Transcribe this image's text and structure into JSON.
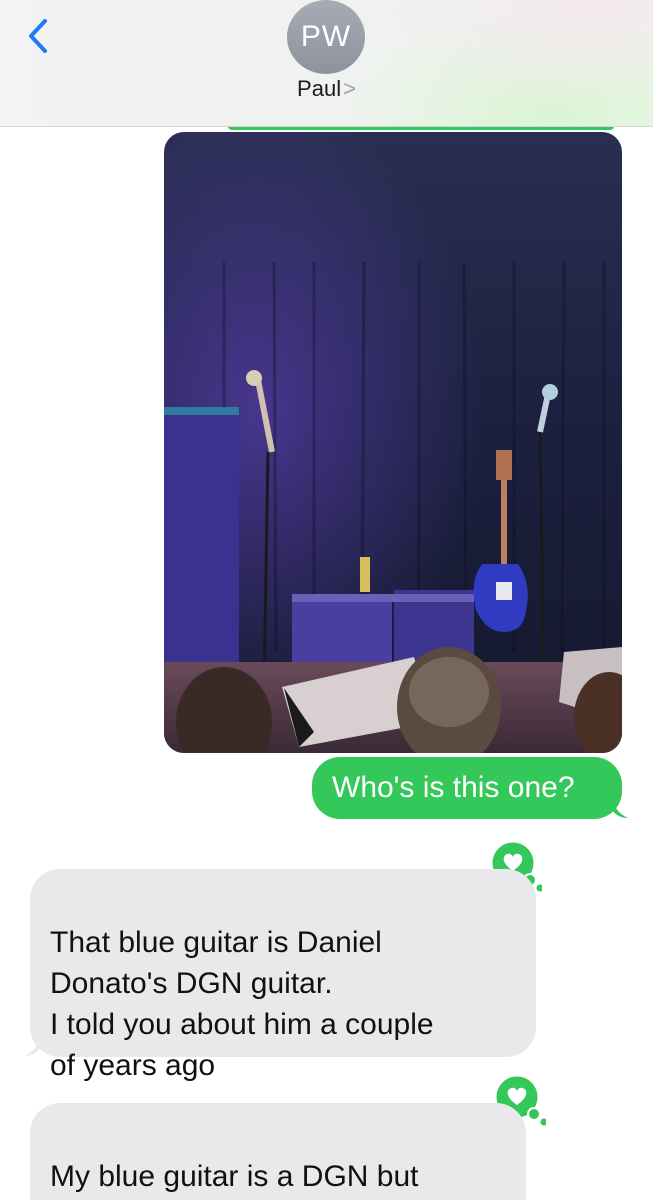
{
  "header": {
    "avatar_initials": "PW",
    "contact_name": "Paul",
    "contact_chevron": ">",
    "back_icon": "chevron-left-icon"
  },
  "messages": [
    {
      "type": "image",
      "direction": "sent",
      "description_icon": "photo-attachment"
    },
    {
      "type": "text",
      "direction": "sent",
      "text": "Who's is this one?"
    },
    {
      "type": "text",
      "direction": "received",
      "text": "That blue guitar is Daniel\nDonato's DGN guitar.\nI told you about him a couple\nof years ago",
      "tapback": "heart-icon"
    },
    {
      "type": "text",
      "direction": "received",
      "text": "My blue guitar is a DGN but\nDaniel's is his signature DGN",
      "tapback": "heart-icon"
    }
  ],
  "colors": {
    "sent_bubble": "#34c759",
    "received_bubble": "#e9e9eb",
    "accent_blue": "#007aff"
  }
}
